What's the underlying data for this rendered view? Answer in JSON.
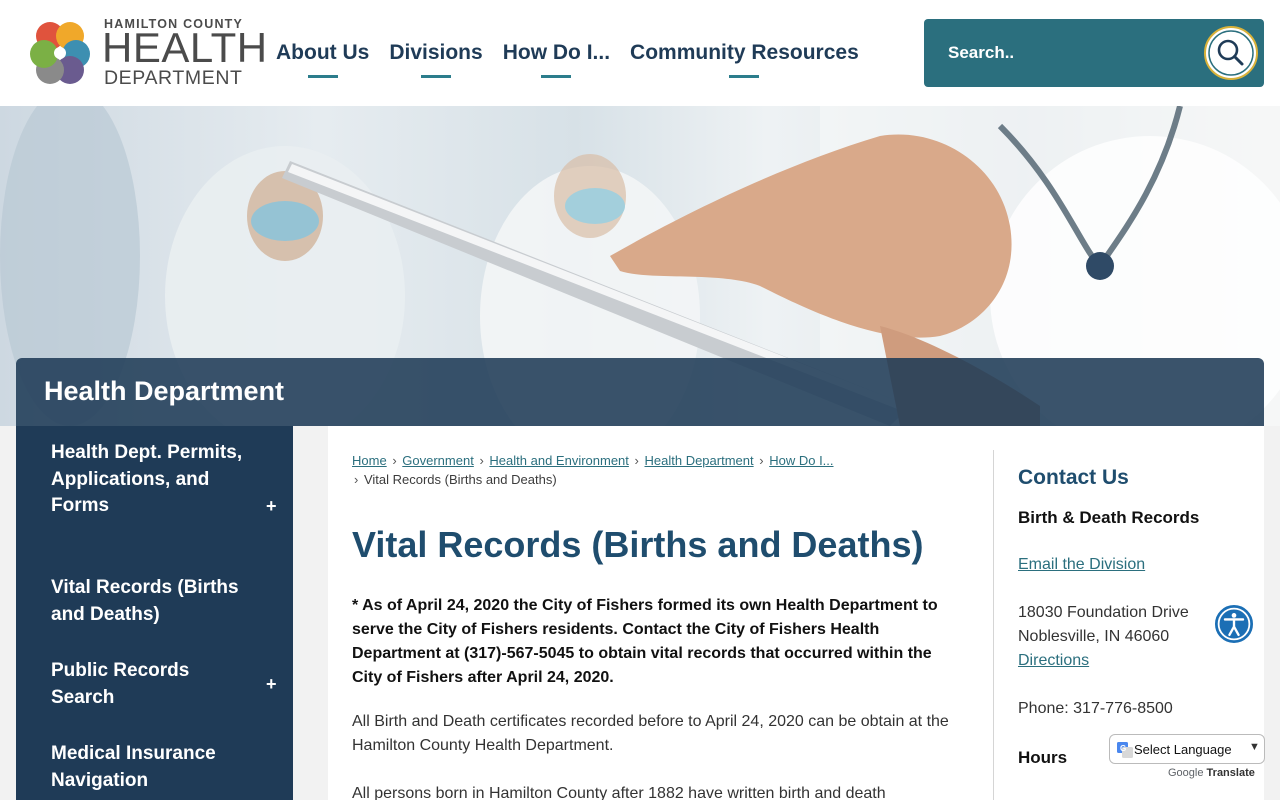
{
  "logo": {
    "line1": "HAMILTON COUNTY",
    "line2": "HEALTH",
    "line3": "DEPARTMENT"
  },
  "nav": {
    "items": [
      "About Us",
      "Divisions",
      "How Do I...",
      "Community Resources"
    ]
  },
  "search": {
    "placeholder": "Search.."
  },
  "hero": {
    "title": "Health Department"
  },
  "sidebar": {
    "items": [
      {
        "label": "Health Dept. Permits, Applications, and Forms",
        "expand": "+"
      },
      {
        "label": "Vital Records (Births and Deaths)"
      },
      {
        "label": "Public Records Search",
        "expand": "+"
      },
      {
        "label": "Medical Insurance Navigation"
      }
    ]
  },
  "breadcrumb": {
    "items": [
      "Home",
      "Government",
      "Health and Environment",
      "Health Department",
      "How Do I..."
    ],
    "current": "Vital Records (Births and Deaths)",
    "separator": "›"
  },
  "main": {
    "title": "Vital Records (Births and Deaths)",
    "notice": "* As of April 24, 2020 the City of Fishers formed its own Health Department to serve the City of Fishers residents.  Contact the City of Fishers Health Department at (317)-567-5045 to obtain vital records that occurred within the City of Fishers after April 24, 2020.",
    "para1": "All Birth and Death certificates recorded before to April 24, 2020 can be obtain at the Hamilton County Health Department.",
    "para2": "All persons born in Hamilton County after 1882 have written birth and death"
  },
  "contact": {
    "heading": "Contact Us",
    "subheading": "Birth & Death Records",
    "email_link": "Email the Division",
    "address_line1": "18030 Foundation Drive",
    "address_line2": "Noblesville, IN 46060",
    "directions_link": "Directions",
    "phone": "Phone: 317-776-8500",
    "hours_heading": "Hours"
  },
  "translate": {
    "select_label": "Select Language",
    "powered_by_prefix": "Google",
    "powered_by_suffix": "Translate"
  },
  "colors": {
    "navy": "#1f3b57",
    "teal": "#2b6f7e",
    "title_blue": "#1f4d6e",
    "accessibility_blue": "#1b6fb5"
  },
  "icons": {
    "search": "magnifier-icon",
    "accessibility": "accessibility-icon",
    "google": "google-g-icon"
  }
}
